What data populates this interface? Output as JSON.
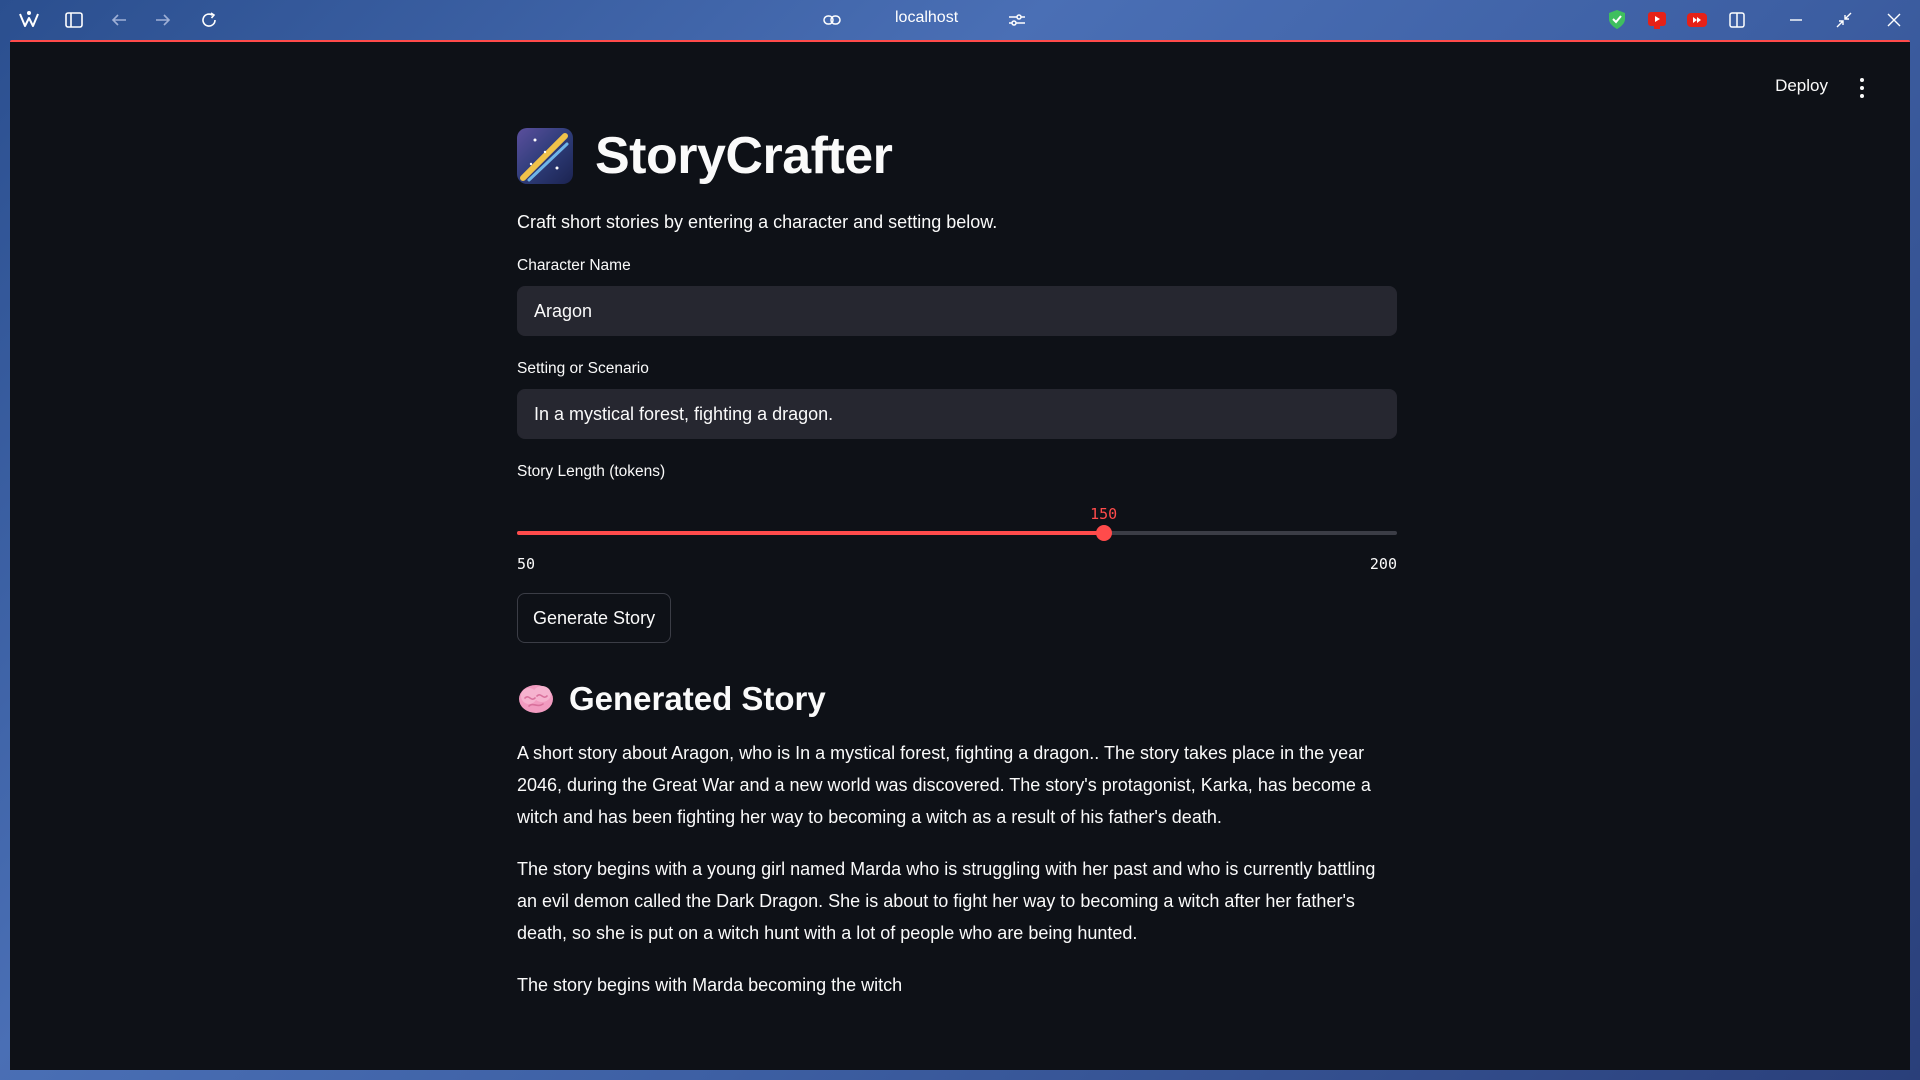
{
  "browser": {
    "url": "localhost"
  },
  "header": {
    "deploy_label": "Deploy"
  },
  "app": {
    "title": "StoryCrafter",
    "subtitle": "Craft short stories by entering a character and setting below."
  },
  "form": {
    "character": {
      "label": "Character Name",
      "value": "Aragon"
    },
    "setting": {
      "label": "Setting or Scenario",
      "value": "In a mystical forest, fighting a dragon."
    },
    "length": {
      "label": "Story Length (tokens)",
      "value": "150",
      "min": "50",
      "max": "200"
    },
    "generate_label": "Generate Story"
  },
  "story": {
    "heading": "Generated Story",
    "paragraphs": [
      "A short story about Aragon, who is In a mystical forest, fighting a dragon.. The story takes place in the year 2046, during the Great War and a new world was discovered. The story's protagonist, Karka, has become a witch and has been fighting her way to becoming a witch as a result of his father's death.",
      "The story begins with a young girl named Marda who is struggling with her past and who is currently battling an evil demon called the Dark Dragon. She is about to fight her way to becoming a witch after her father's death, so she is put on a witch hunt with a lot of people who are being hunted.",
      "The story begins with Marda becoming the witch"
    ]
  },
  "colors": {
    "accent": "#ff4b4b",
    "background": "#0e1117",
    "input_bg": "#262730",
    "text": "#fafafa"
  },
  "icons": {
    "title": "shooting-star-emoji-icon",
    "story": "brain-emoji-icon"
  }
}
